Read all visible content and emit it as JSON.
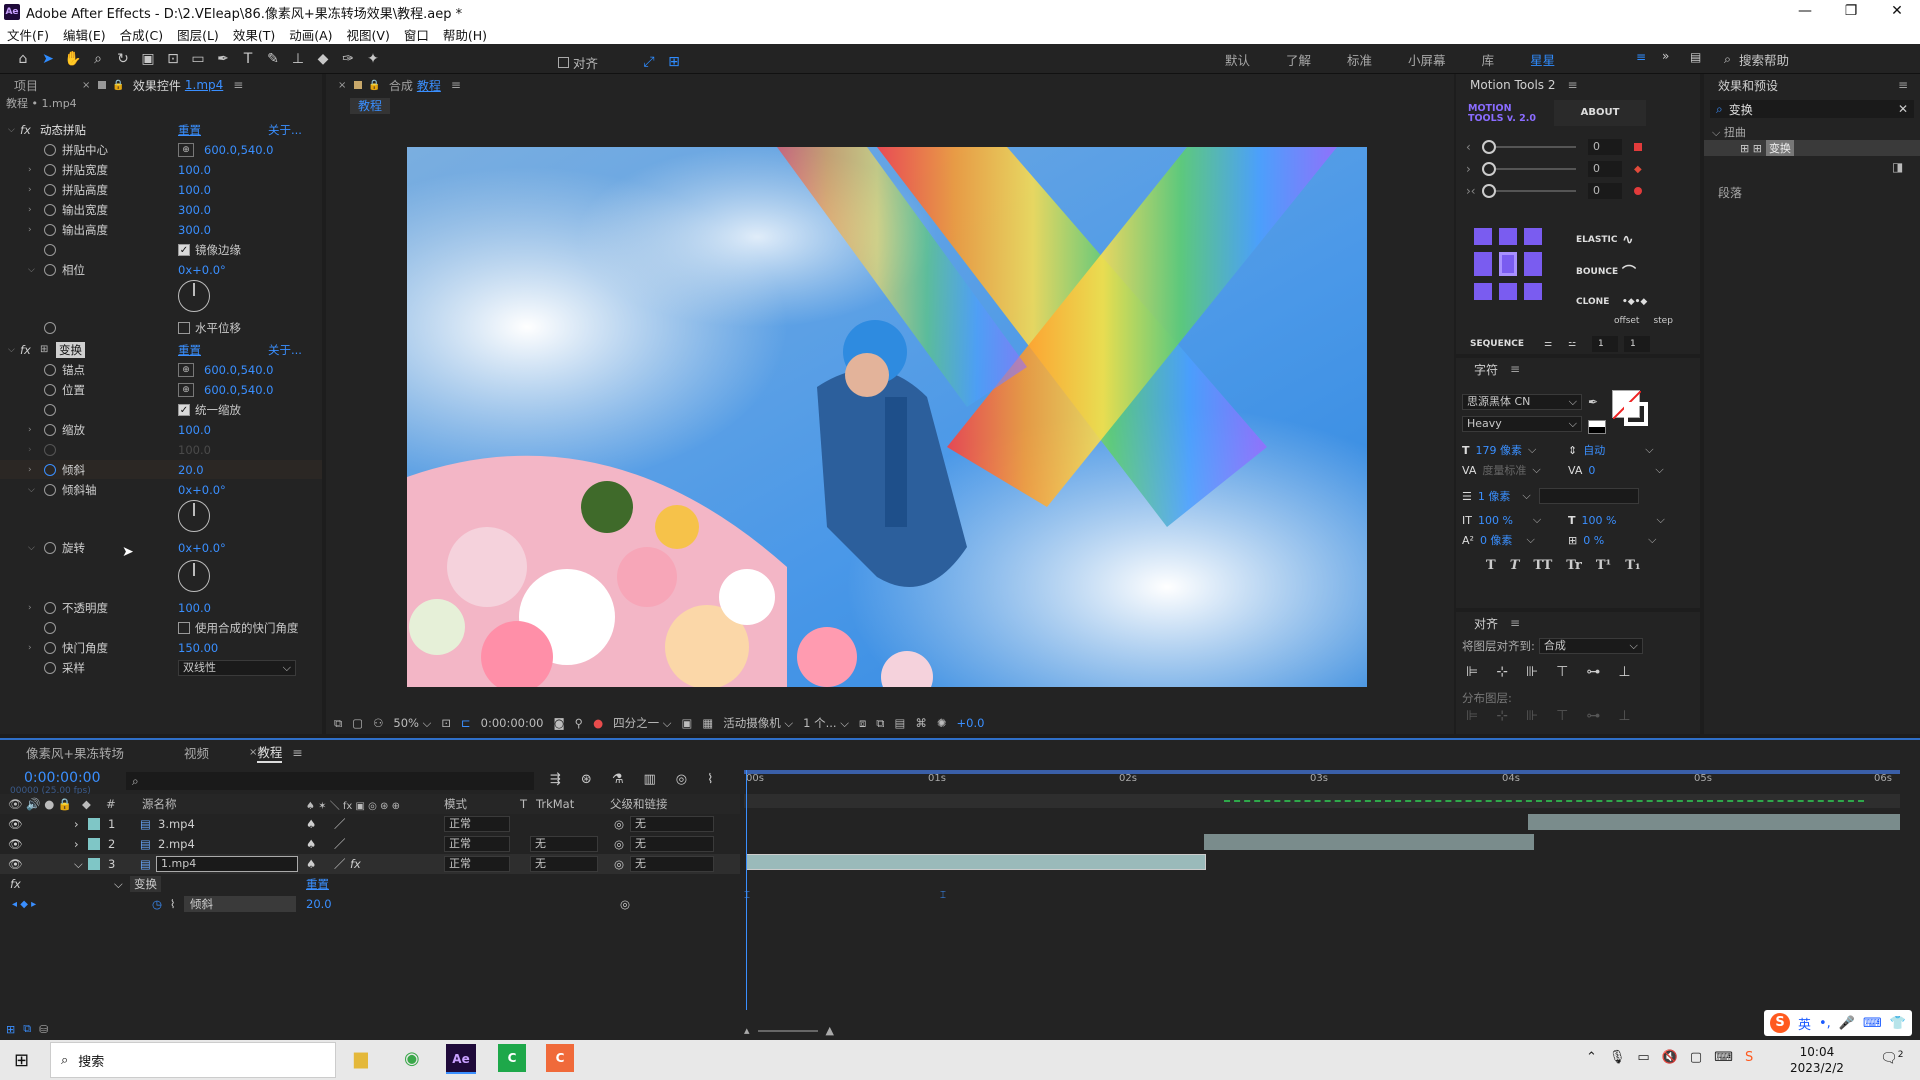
{
  "window": {
    "title": "Adobe After Effects - D:\\2.VEleap\\86.像素风+果冻转场效果\\教程.aep *",
    "app_icon": "Ae"
  },
  "menu": [
    "文件(F)",
    "编辑(E)",
    "合成(C)",
    "图层(L)",
    "效果(T)",
    "动画(A)",
    "视图(V)",
    "窗口",
    "帮助(H)"
  ],
  "toolbar": {
    "align_label": "对齐",
    "workspaces": [
      "默认",
      "了解",
      "标准",
      "小屏幕",
      "库",
      "星星"
    ],
    "active_workspace": "星星",
    "search_help": "搜索帮助"
  },
  "effect_panel": {
    "tab_project": "项目",
    "tab_effect": "效果控件",
    "tab_effect_layer": "1.mp4",
    "breadcrumb": "教程 • 1.mp4",
    "fx1": {
      "name": "动态拼贴",
      "reset": "重置",
      "about": "关于...",
      "props": [
        {
          "label": "拼贴中心",
          "value": "600.0,540.0"
        },
        {
          "label": "拼贴宽度",
          "value": "100.0"
        },
        {
          "label": "拼贴高度",
          "value": "100.0"
        },
        {
          "label": "输出宽度",
          "value": "300.0"
        },
        {
          "label": "输出高度",
          "value": "300.0"
        }
      ],
      "mirror_edges": "镜像边缘",
      "phase_label": "相位",
      "phase_value": "0x+0.0°",
      "horizontal_shift": "水平位移"
    },
    "fx2": {
      "name": "变换",
      "reset": "重置",
      "about": "关于...",
      "anchor_label": "锚点",
      "anchor_value": "600.0,540.0",
      "position_label": "位置",
      "position_value": "600.0,540.0",
      "uniform_scale": "统一缩放",
      "scale_label": "缩放",
      "scale_value": "100.0",
      "scale_disabled_value": "100.0",
      "skew_label": "倾斜",
      "skew_value": "20.0",
      "skew_axis_label": "倾斜轴",
      "skew_axis_value": "0x+0.0°",
      "rotation_label": "旋转",
      "rotation_value": "0x+0.0°",
      "opacity_label": "不透明度",
      "opacity_value": "100.0",
      "comp_shutter": "使用合成的快门角度",
      "shutter_label": "快门角度",
      "shutter_value": "150.00",
      "sampling_label": "采样",
      "sampling_value": "双线性"
    }
  },
  "comp_panel": {
    "header": "合成",
    "comp_name": "教程",
    "tab": "教程",
    "footer": {
      "zoom": "50%",
      "timecode": "0:00:00:00",
      "resolution": "四分之一",
      "camera": "活动摄像机",
      "views": "1 个...",
      "exposure": "+0.0"
    }
  },
  "motion_tools": {
    "title": "Motion Tools 2",
    "logo_line1": "MOTION",
    "logo_line2": "TOOLS v. 2.0",
    "about": "ABOUT",
    "sliders": [
      {
        "icon": "‹",
        "value": "0",
        "dot_color": "#e23b3b"
      },
      {
        "icon": "›",
        "value": "0",
        "dot_color": "#e24b3b"
      },
      {
        "icon": "›‹",
        "value": "0",
        "dot_color": "#e23b3b"
      }
    ],
    "elastic": "ELASTIC",
    "bounce": "BOUNCE",
    "clone": "CLONE",
    "offset": "offset",
    "step": "step",
    "sequence": "SEQUENCE",
    "seq_val1": "1",
    "seq_val2": "1",
    "grid_color": "#7a5cf0"
  },
  "character": {
    "title": "字符",
    "font": "思源黑体 CN",
    "style": "Heavy",
    "size": "179 像素",
    "leading": "自动",
    "kerning": "度量标准",
    "tracking": "0",
    "stroke": "1 像素",
    "vscale": "100 %",
    "hscale": "100 %",
    "baseline": "0 像素",
    "tsume": "0 %",
    "styles": [
      "T",
      "T",
      "TT",
      "Tr",
      "T¹",
      "T₁"
    ]
  },
  "align": {
    "title": "对齐",
    "align_to_label": "将图层对齐到:",
    "align_to_value": "合成",
    "distribute": "分布图层:"
  },
  "effects_presets": {
    "title": "效果和预设",
    "search": "变换",
    "category": "扭曲",
    "item": "变换",
    "paragraph": "段落"
  },
  "timeline": {
    "tabs": [
      "像素风+果冻转场",
      "视频",
      "教程"
    ],
    "active_tab": "教程",
    "timecode": "0:00:00:00",
    "timecode_sub": "00000 (25.00 fps)",
    "col_source": "源名称",
    "col_mode": "模式",
    "col_t": "T",
    "col_trkmat": "TrkMat",
    "col_parent": "父级和链接",
    "layers": [
      {
        "num": "1",
        "name": "3.mp4",
        "mode": "正常",
        "trkmat": "",
        "parent": "无",
        "color": "#7fc6c6"
      },
      {
        "num": "2",
        "name": "2.mp4",
        "mode": "正常",
        "trkmat": "无",
        "parent": "无",
        "color": "#7fc6c6"
      },
      {
        "num": "3",
        "name": "1.mp4",
        "mode": "正常",
        "trkmat": "无",
        "parent": "无",
        "color": "#7fc6c6"
      }
    ],
    "fx_group": "变换",
    "fx_reset": "重置",
    "prop_label": "倾斜",
    "prop_value": "20.0",
    "ruler": [
      "00s",
      "01s",
      "02s",
      "03s",
      "04s",
      "05s",
      "06s"
    ]
  },
  "taskbar": {
    "search": "搜索",
    "time": "10:04",
    "date": "2023/2/2",
    "ime": "英",
    "notif_count": "2"
  }
}
